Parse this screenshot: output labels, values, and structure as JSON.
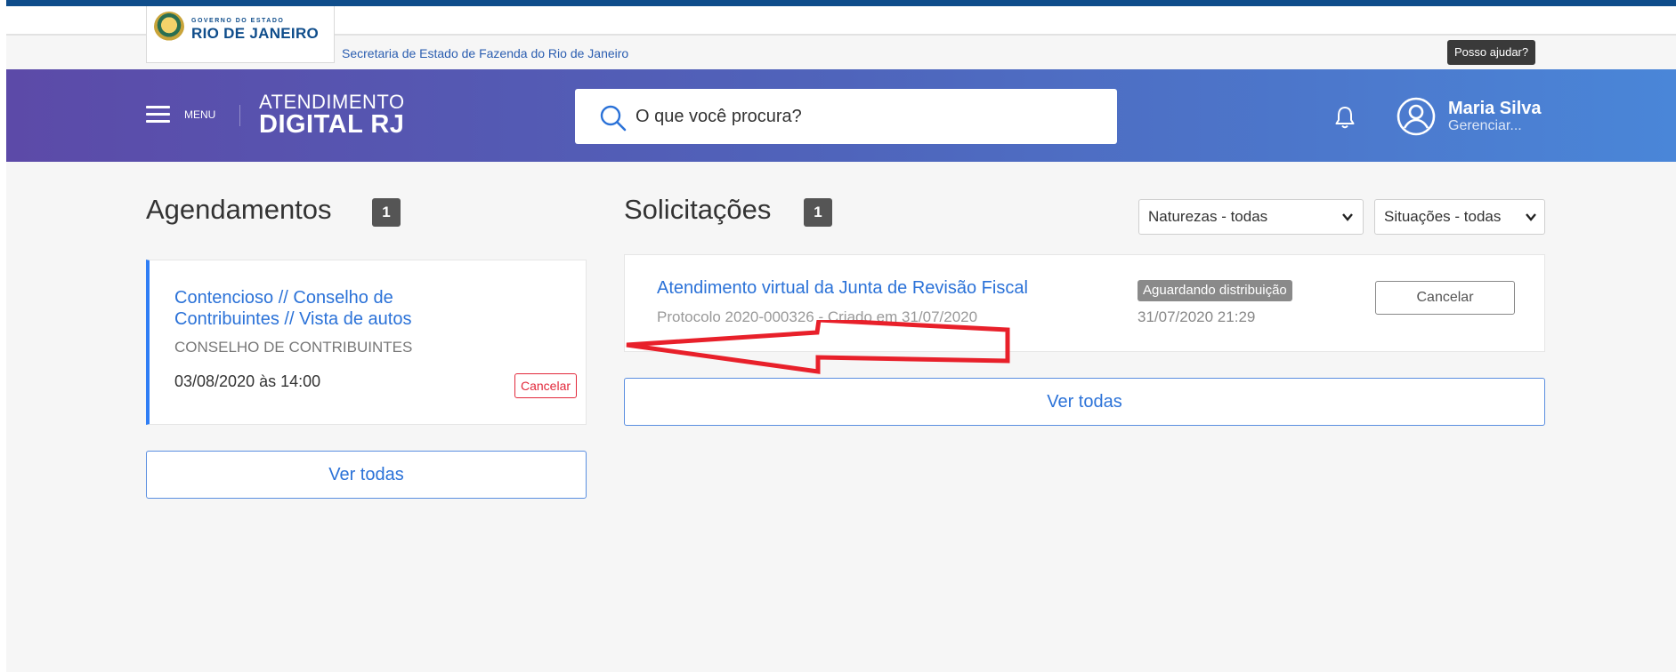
{
  "gov_bar": {
    "logo_small": "GOVERNO DO ESTADO",
    "logo_big": "RIO DE JANEIRO",
    "secretaria": "Secretaria de Estado de Fazenda do Rio de Janeiro",
    "help_button": "Posso ajudar?"
  },
  "header": {
    "menu_label": "MENU",
    "brand_top": "ATENDIMENTO",
    "brand_bottom": "DIGITAL RJ",
    "search_placeholder": "O que você procura?",
    "user_name": "Maria Silva",
    "user_manage": "Gerenciar..."
  },
  "agendamentos": {
    "title": "Agendamentos",
    "count": "1",
    "card": {
      "title": "Contencioso // Conselho de Contribuintes // Vista de autos",
      "org": "CONSELHO DE CONTRIBUINTES",
      "datetime": "03/08/2020 às 14:00",
      "cancel_label": "Cancelar"
    },
    "ver_todas": "Ver todas"
  },
  "solicitacoes": {
    "title": "Solicitações",
    "count": "1",
    "filter_natureza": "Naturezas - todas",
    "filter_situacao": "Situações - todas",
    "card": {
      "title": "Atendimento virtual da Junta de Revisão Fiscal",
      "protocolo": "Protocolo 2020-000326 - Criado em 31/07/2020",
      "status": "Aguardando distribuição",
      "datetime": "31/07/2020 21:29",
      "cancel_label": "Cancelar"
    },
    "ver_todas": "Ver todas"
  },
  "colors": {
    "accent_blue": "#2b72d8",
    "cancel_red": "#e2283a",
    "header_gradient_start": "#5c4aa8",
    "header_gradient_end": "#4a86d8",
    "annotation_arrow": "#e8202a"
  }
}
